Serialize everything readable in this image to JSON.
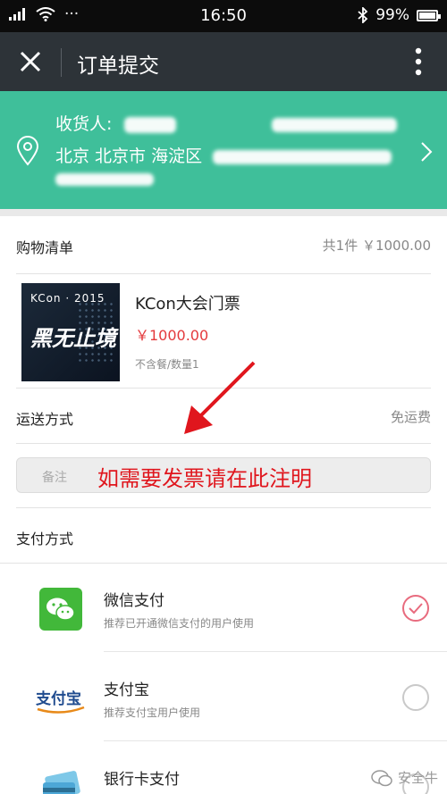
{
  "status": {
    "time": "16:50",
    "battery": "99%",
    "battery_level": 0.99
  },
  "nav": {
    "title": "订单提交"
  },
  "address": {
    "receiver_label": "收货人:",
    "location": "北京 北京市 海淀区"
  },
  "cart": {
    "header": "购物清单",
    "summary": "共1件   ￥1000.00",
    "product": {
      "image_text_top": "KCon · 2015",
      "image_text_big": "黑无止境",
      "name": "KCon大会门票",
      "price": "￥1000.00",
      "meta": "不含餐/数量1"
    }
  },
  "shipping": {
    "label": "运送方式",
    "value": "免运费"
  },
  "note": {
    "placeholder": "备注",
    "callout": "如需要发票请在此注明"
  },
  "payment": {
    "header": "支付方式",
    "methods": [
      {
        "name": "微信支付",
        "desc": "推荐已开通微信支付的用户使用",
        "selected": true,
        "icon": "wechat-pay-icon"
      },
      {
        "name": "支付宝",
        "desc": "推荐支付宝用户使用",
        "selected": false,
        "icon": "alipay-icon",
        "icon_text": "支付宝"
      },
      {
        "name": "银行卡支付",
        "desc": "",
        "selected": false,
        "icon": "bank-card-icon"
      }
    ]
  },
  "watermark": "安全牛",
  "colors": {
    "header_bg": "#2d3338",
    "address_bg": "#3fbf9a",
    "price": "#e4393c",
    "callout": "#e0161d"
  }
}
